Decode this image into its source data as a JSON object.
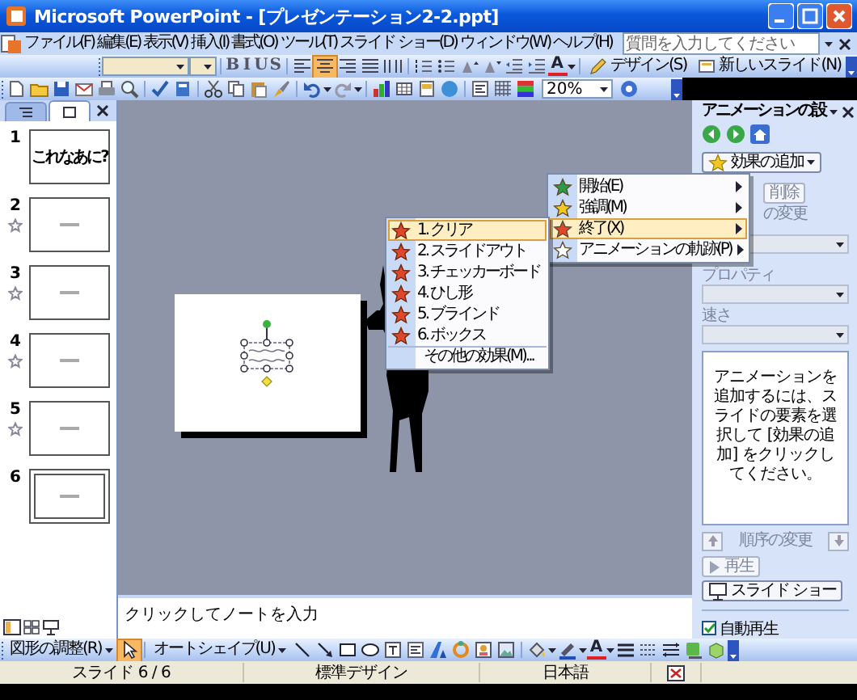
{
  "window": {
    "title": "Microsoft PowerPoint - [プレゼンテーション2-2.ppt]"
  },
  "menu_bar": {
    "items": [
      "ファイル(F)",
      "編集(E)",
      "表示(V)",
      "挿入(I)",
      "書式(O)",
      "ツール(T)",
      "スライド ショー(D)",
      "ウィンドウ(W)",
      "ヘルプ(H)"
    ],
    "help_search": {
      "placeholder": "質問を入力してください"
    }
  },
  "formatting_toolbar": {
    "style_buttons": [
      "B",
      "I",
      "U",
      "S"
    ],
    "alignment_buttons": [
      {
        "selected": false
      },
      {
        "selected": true
      },
      {
        "selected": false
      },
      {
        "selected": false
      },
      {
        "selected": false
      }
    ],
    "font_color_button": "A",
    "design_button": "デザイン(S)",
    "new_slide_button": "新しいスライド(N)"
  },
  "standard_toolbar": {
    "zoom": "20%"
  },
  "slides_pane": {
    "tabs": [
      {
        "kind": "outline",
        "selected": false
      },
      {
        "kind": "slides",
        "selected": true
      }
    ],
    "slides": [
      {
        "number": "1",
        "title": "これなあに?",
        "animated": false,
        "selected": false
      },
      {
        "number": "2",
        "animated": true,
        "selected": false
      },
      {
        "number": "3",
        "animated": true,
        "selected": false
      },
      {
        "number": "4",
        "animated": true,
        "selected": false
      },
      {
        "number": "5",
        "animated": true,
        "selected": false
      },
      {
        "number": "6",
        "animated": false,
        "selected": true
      }
    ]
  },
  "effect_menu": {
    "items": [
      {
        "label": "開始(E)",
        "color": "#2e9a48",
        "selected": false
      },
      {
        "label": "強調(M)",
        "color": "#f2c81e",
        "selected": false
      },
      {
        "label": "終了(X)",
        "color": "#e0462a",
        "selected": true
      },
      {
        "label": "アニメーションの軌跡(P)",
        "color": "#ffffff",
        "selected": false
      }
    ]
  },
  "exit_submenu": {
    "items": [
      {
        "kind": "effect",
        "label": "1. クリア",
        "selected": true
      },
      {
        "kind": "effect",
        "label": "2. スライドアウト",
        "selected": false
      },
      {
        "kind": "effect",
        "label": "3. チェッカーボード",
        "selected": false
      },
      {
        "kind": "effect",
        "label": "4. ひし形",
        "selected": false
      },
      {
        "kind": "effect",
        "label": "5. ブラインド",
        "selected": false
      },
      {
        "kind": "effect",
        "label": "6. ボックス",
        "selected": false
      },
      {
        "kind": "more",
        "label": "その他の効果(M)...",
        "selected": false
      }
    ]
  },
  "notes": {
    "placeholder": "クリックしてノートを入力"
  },
  "task_pane": {
    "title": "アニメーションの設",
    "add_effect_button": "効果の追加",
    "remove_button": {
      "label": "削除",
      "disabled": true
    },
    "change_label": "の変更",
    "property_label": "プロパティ",
    "speed_label": "速さ",
    "hint": "アニメーションを追加するには、スライドの要素を選択して [効果の追加] をクリックしてください。",
    "reorder_label": "順序の変更",
    "play_button": {
      "label": "再生",
      "disabled": true
    },
    "slideshow_button": "スライド ショー",
    "autoplay": {
      "label": "自動再生",
      "checked": true
    }
  },
  "drawing_toolbar": {
    "arrange_button": "図形の調整(R)",
    "pointer_tool": {
      "selected": true
    },
    "autoshape_button": "オートシェイプ(U)",
    "font_color_button": "A"
  },
  "status_bar": {
    "slide_position": "スライド 6 / 6",
    "design": "標準デザイン",
    "language": "日本語"
  }
}
